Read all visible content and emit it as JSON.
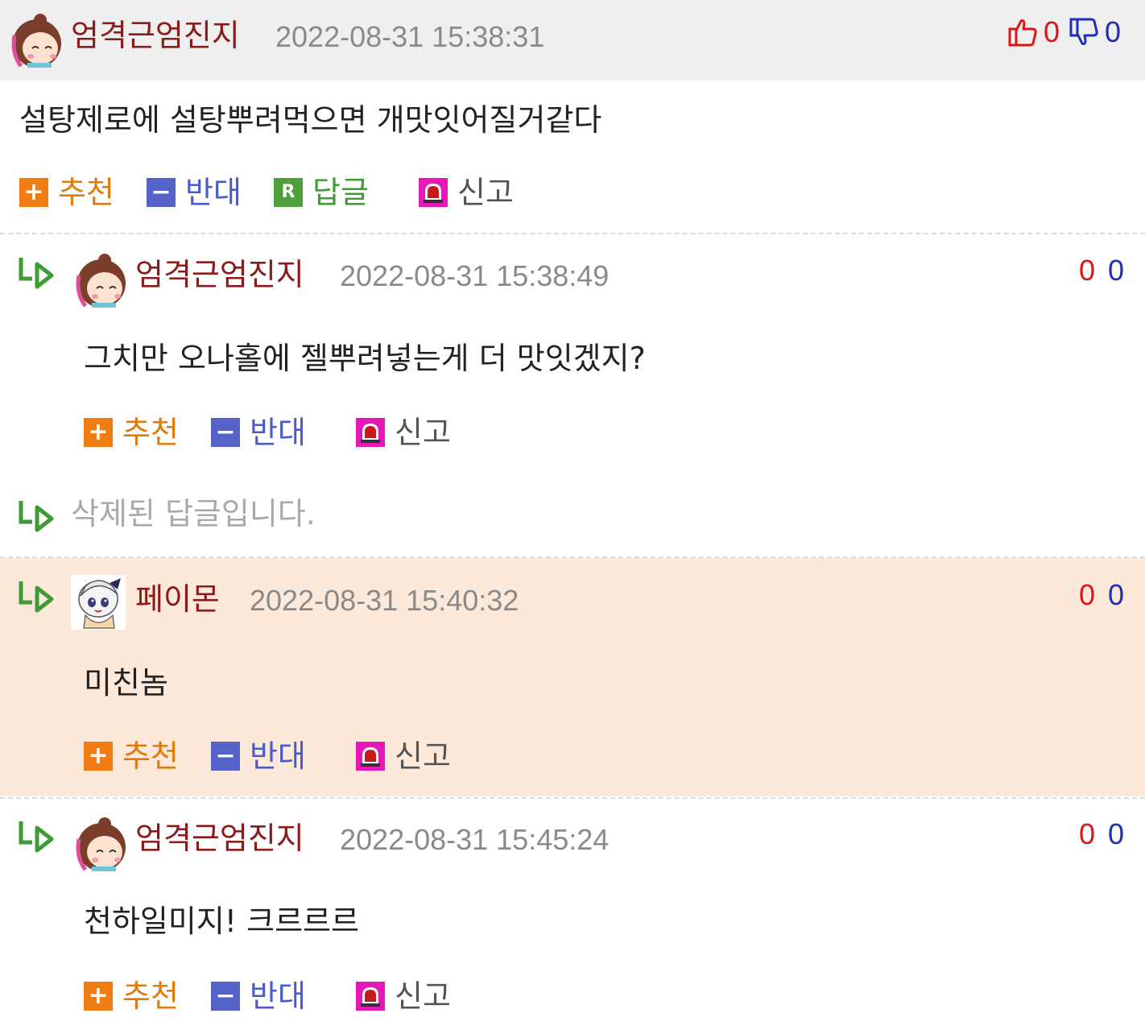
{
  "comments": [
    {
      "nick": "엄격근엄진지",
      "date": "2022-08-31 15:38:31",
      "text": "설탕제로에 설탕뿌려먹으면 개맛잇어질거같다",
      "likes": "0",
      "dislikes": "0"
    },
    {
      "nick": "엄격근엄진지",
      "date": "2022-08-31 15:38:49",
      "text": "그치만 오나홀에 젤뿌려넣는게 더 맛잇겠지?",
      "likes": "0",
      "dislikes": "0"
    },
    {
      "deleted_text": "삭제된 답글입니다."
    },
    {
      "nick": "페이몬",
      "date": "2022-08-31 15:40:32",
      "text": "미친놈",
      "likes": "0",
      "dislikes": "0"
    },
    {
      "nick": "엄격근엄진지",
      "date": "2022-08-31 15:45:24",
      "text": "천하일미지! 크르르르",
      "likes": "0",
      "dislikes": "0"
    }
  ],
  "actions": {
    "recommend": "추천",
    "oppose": "반대",
    "reply": "답글",
    "report": "신고",
    "plus_glyph": "+",
    "minus_glyph": "−",
    "reply_glyph": "R"
  },
  "colors": {
    "header_bg": "#efefef",
    "highlight_bg": "#fce9d9",
    "nick": "#8b1a1a",
    "like": "#d81818",
    "dislike": "#1f2fb8"
  }
}
